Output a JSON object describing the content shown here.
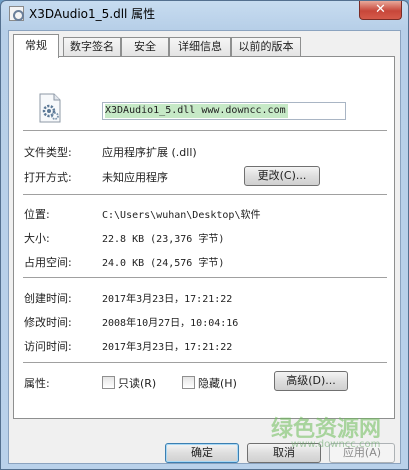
{
  "window": {
    "title": "X3DAudio1_5.dll 属性",
    "close_label": "✕"
  },
  "tabs": [
    {
      "label": "常规",
      "active": true
    },
    {
      "label": "数字签名",
      "active": false
    },
    {
      "label": "安全",
      "active": false
    },
    {
      "label": "详细信息",
      "active": false
    },
    {
      "label": "以前的版本",
      "active": false
    }
  ],
  "general": {
    "file_icon": "dll-gear-file-icon",
    "name_field": "X3DAudio1_5.dll  www.downcc.com",
    "file_type_label": "文件类型:",
    "file_type_value": "应用程序扩展 (.dll)",
    "opens_with_label": "打开方式:",
    "opens_with_value": "未知应用程序",
    "change_button": "更改(C)...",
    "location_label": "位置:",
    "location_value": "C:\\Users\\wuhan\\Desktop\\软件",
    "size_label": "大小:",
    "size_value": "22.8 KB (23,376 字节)",
    "size_on_disk_label": "占用空间:",
    "size_on_disk_value": "24.0 KB (24,576 字节)",
    "created_label": "创建时间:",
    "created_value": "2017年3月23日，17:21:22",
    "modified_label": "修改时间:",
    "modified_value": "2008年10月27日，10:04:16",
    "accessed_label": "访问时间:",
    "accessed_value": "2017年3月23日，17:21:22",
    "attributes_label": "属性:",
    "readonly_label": "只读(R)",
    "readonly_checked": false,
    "hidden_label": "隐藏(H)",
    "hidden_checked": false,
    "advanced_button": "高级(D)..."
  },
  "footer": {
    "ok_button": "确定",
    "cancel_button": "取消",
    "apply_button": "应用(A)"
  },
  "watermark": {
    "text": "绿色资源网",
    "sub": "www.downcc.com"
  }
}
